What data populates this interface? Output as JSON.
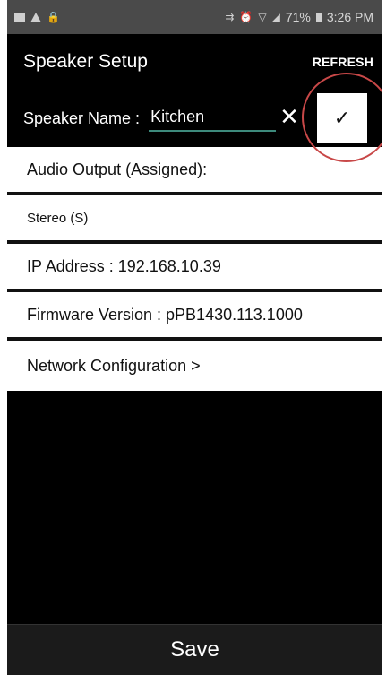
{
  "status_bar": {
    "battery_percent": "71%",
    "time": "3:26 PM"
  },
  "header": {
    "title": "Speaker Setup",
    "refresh_label": "REFRESH"
  },
  "speaker_name": {
    "label": "Speaker Name :",
    "value": "Kitchen",
    "clear_icon": "✕",
    "confirm_icon": "✓"
  },
  "items": [
    {
      "label": "Audio Output (Assigned):"
    },
    {
      "label": "Stereo (S)"
    },
    {
      "label": "IP  Address : 192.168.10.39"
    },
    {
      "label": "Firmware  Version : pPB1430.113.1000"
    },
    {
      "label": "Network  Configuration >"
    }
  ],
  "save_label": "Save",
  "colors": {
    "accent_underline": "#3d8a7c",
    "highlight_ring": "#c84848"
  }
}
